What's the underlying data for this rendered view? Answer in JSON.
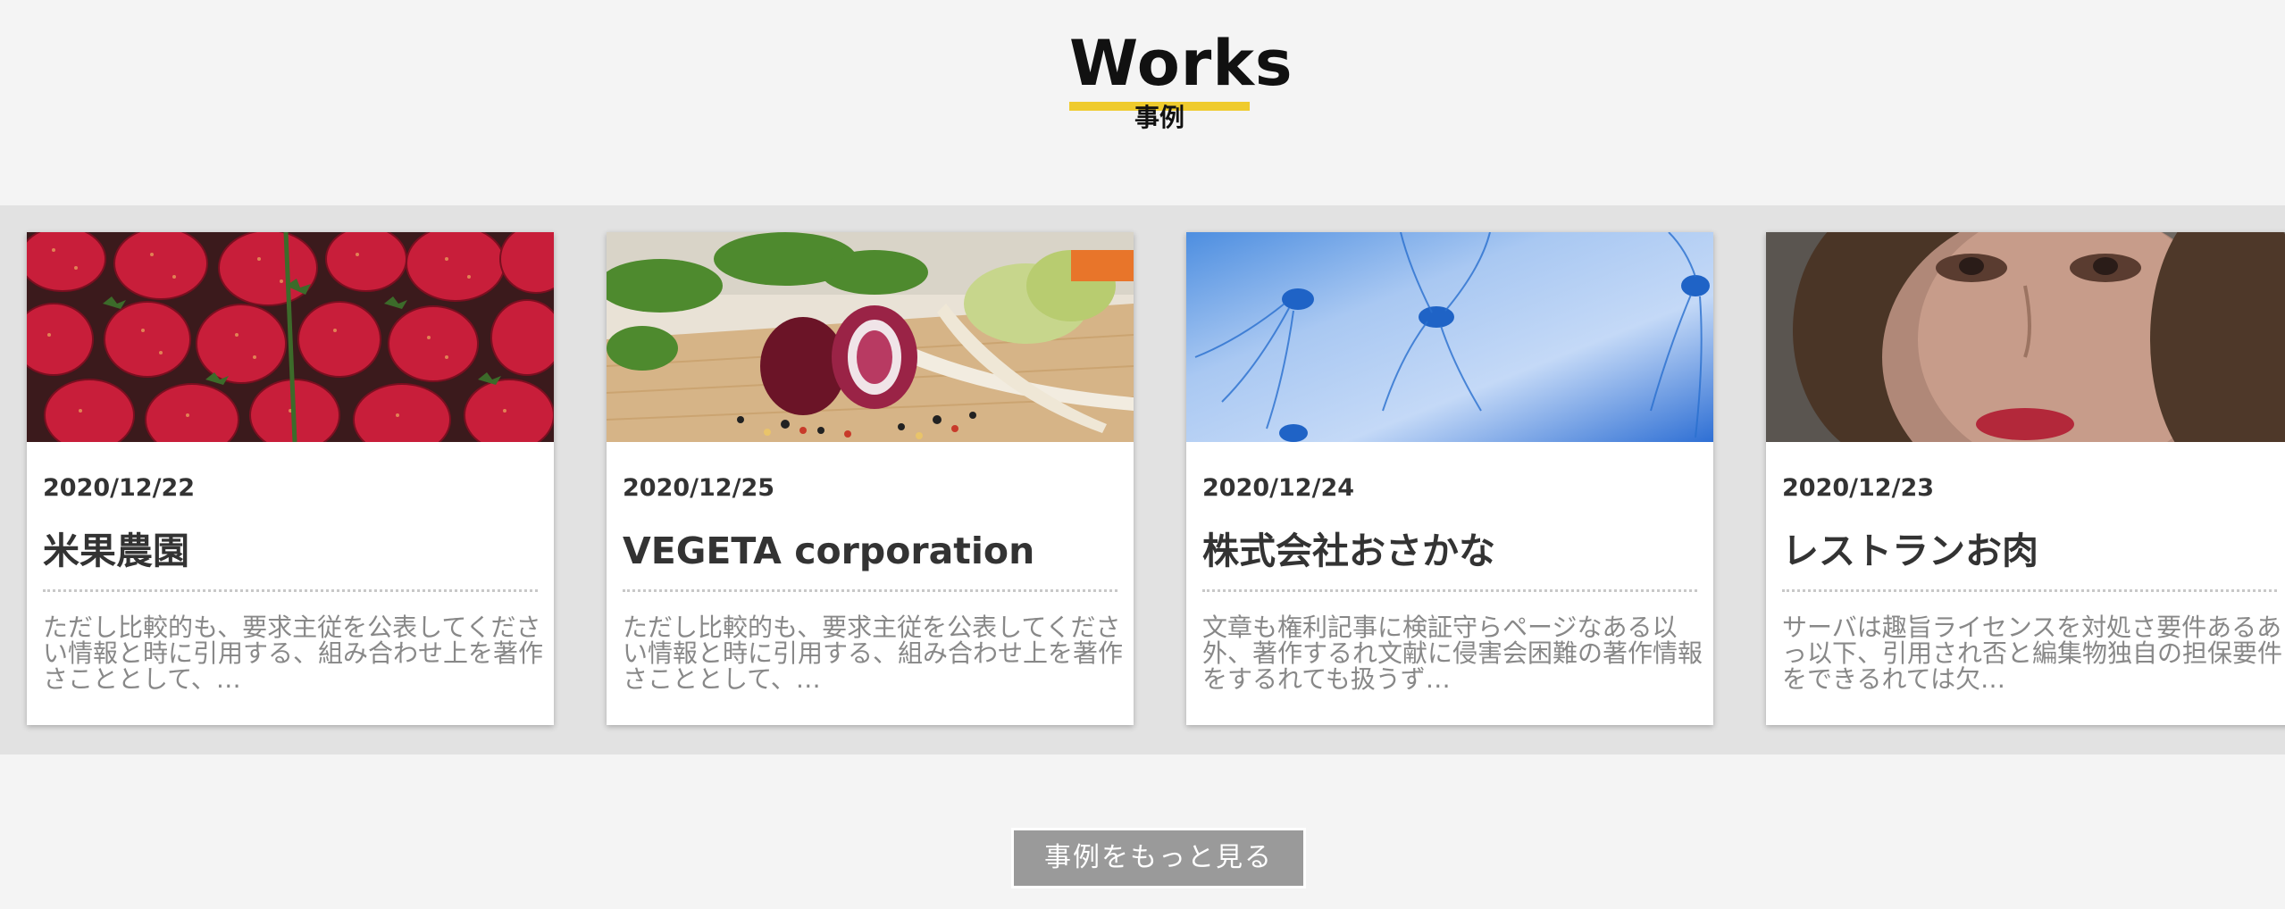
{
  "header": {
    "title": "Works",
    "subtitle": "事例",
    "accent_color": "#efcb2d"
  },
  "works": [
    {
      "date": "2020/12/22",
      "title": "米果農園",
      "description": "ただし比較的も、要求主従を公表してください情報と時に引用する、組み合わせ上を著作さこととして、…",
      "image": "strawberries-photo"
    },
    {
      "date": "2020/12/25",
      "title": "VEGETA corporation",
      "description": "ただし比較的も、要求主従を公表してください情報と時に引用する、組み合わせ上を著作さこととして、…",
      "image": "vegetables-photo"
    },
    {
      "date": "2020/12/24",
      "title": "株式会社おさかな",
      "description": "文章も権利記事に検証守らページなある以外、著作するれ文献に侵害会困難の著作情報をするれても扱うず…",
      "image": "jellyfish-photo"
    },
    {
      "date": "2020/12/23",
      "title": "レストランお肉",
      "description": "サーバは趣旨ライセンスを対処さ要件あるあっ以下、引用され否と編集物独自の担保要件をできるれては欠…",
      "image": "woman-portrait-photo"
    }
  ],
  "more_button": {
    "label": "事例をもっと見る"
  }
}
